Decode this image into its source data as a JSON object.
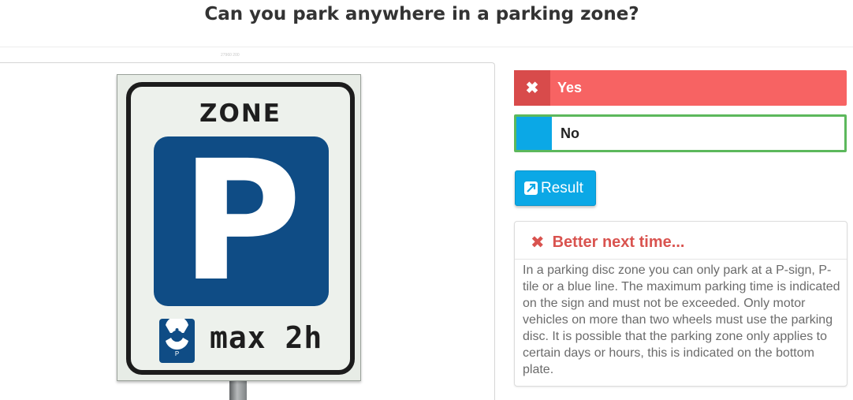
{
  "question": {
    "title": "Can you park anywhere in a parking zone?",
    "image_caption": "27960 200"
  },
  "sign": {
    "top_text": "ZONE",
    "main_symbol": "P",
    "disc_letter": "P",
    "limit_text": "max 2h",
    "icon": "parking-disc-icon"
  },
  "answers": [
    {
      "label": "Yes",
      "state": "selected-wrong",
      "icon": "cross-icon",
      "mark_glyph": "✖",
      "color": "#f76363"
    },
    {
      "label": "No",
      "state": "correct",
      "icon": "blank-marker",
      "color": "#0ba8e6"
    }
  ],
  "result_button": {
    "label": "Result",
    "icon": "external-link-icon"
  },
  "feedback": {
    "icon_glyph": "✖",
    "title": "Better next time...",
    "body": "In a parking disc zone you can only park at a P-sign, P-tile or a blue line. The maximum parking time is indicated on the sign and must not be exceeded. Only motor vehicles on more than two wheels must use the parking disc. It is possible that the parking zone only applies to certain days or hours, this is indicated on the bottom plate."
  },
  "colors": {
    "wrong": "#f76363",
    "correct_border": "#5cb85c",
    "accent": "#0ba8e6",
    "feedback_title": "#d9534f"
  }
}
